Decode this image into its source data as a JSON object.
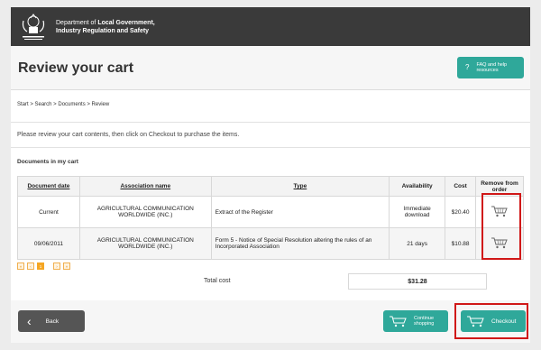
{
  "banner": {
    "line1_prefix": "Department of ",
    "line1_bold": "Local Government,",
    "line2": "Industry Regulation and Safety",
    "crest_text": "GOVERNMENT OF\nWESTERN AUSTRALIA"
  },
  "header": {
    "title": "Review your cart",
    "faq_label_line1": "FAQ and help",
    "faq_label_line2": "resources",
    "faq_icon": "?"
  },
  "breadcrumb": "Start > Search > Documents > Review",
  "instructions": "Please review your cart contents, then click on Checkout to purchase the items.",
  "section_title": "Documents in my cart",
  "table": {
    "columns": [
      "Document date",
      "Association name",
      "Type",
      "Availability",
      "Cost",
      "Remove from order"
    ],
    "rows": [
      {
        "date": "Current",
        "association": "AGRICULTURAL COMMUNICATION WORLDWIDE (INC.)",
        "type": "Extract of the Register",
        "availability": "Immediate download",
        "cost": "$20.40",
        "remove_icon": "cart-remove-icon"
      },
      {
        "date": "09/06/2011",
        "association": "AGRICULTURAL COMMUNICATION WORLDWIDE (INC.)",
        "type": "Form 5 - Notice of Special Resolution altering the rules of an Incorporated Association",
        "availability": "21 days",
        "cost": "$10.88",
        "remove_icon": "cart-remove-icon"
      }
    ]
  },
  "pagination": {
    "first": "«",
    "prev": "‹",
    "current": "1",
    "next": "›",
    "last": "»"
  },
  "total": {
    "label": "Total cost",
    "value": "$31.28"
  },
  "footer": {
    "back_label": "Back",
    "continue_line1": "Continue",
    "continue_line2": "shopping",
    "checkout_label": "Checkout"
  },
  "colors": {
    "accent": "#2fa89a",
    "banner": "#3a3a3a",
    "highlight": "#d01818",
    "pager": "#f5a623"
  }
}
